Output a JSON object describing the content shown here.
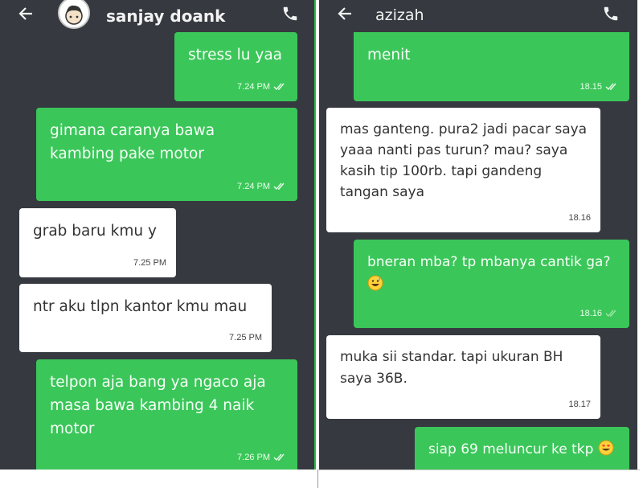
{
  "left_chat": {
    "contact_name": "sanjay doank",
    "messages": [
      {
        "dir": "out",
        "text": "stress lu yaa",
        "time": "7.24 PM"
      },
      {
        "dir": "out",
        "text": "gimana caranya bawa\nkambing pake motor",
        "time": "7.24 PM"
      },
      {
        "dir": "in",
        "text": "grab baru kmu y",
        "time": "7.25 PM"
      },
      {
        "dir": "in",
        "text": "ntr aku tlpn kantor kmu mau",
        "time": "7.25 PM"
      },
      {
        "dir": "out",
        "text": "telpon aja bang ya ngaco aja\nmasa bawa kambing 4 naik\nmotor",
        "time": "7.26 PM"
      }
    ]
  },
  "right_chat": {
    "contact_name": "azizah",
    "messages": [
      {
        "dir": "out",
        "text": "menit",
        "time": "18.15"
      },
      {
        "dir": "in",
        "text": "mas ganteng. pura2 jadi pacar saya\nyaaa nanti pas turun? mau? saya\nkasih tip 100rb. tapi gandeng\ntangan saya",
        "time": "18.16"
      },
      {
        "dir": "out",
        "text": "bneran mba? tp mbanya cantik ga?",
        "emoji": "grinning-sweat-emoji",
        "time": "18.16"
      },
      {
        "dir": "in",
        "text": "muka sii standar. tapi ukuran BH\nsaya 36B.",
        "time": "18.17"
      },
      {
        "dir": "out",
        "text": "siap 69 meluncur ke tkp",
        "emoji": "heart-eyes-emoji",
        "time": ""
      }
    ]
  },
  "colors": {
    "background": "#363a40",
    "outgoing": "#3bc65a",
    "incoming": "#ffffff"
  }
}
